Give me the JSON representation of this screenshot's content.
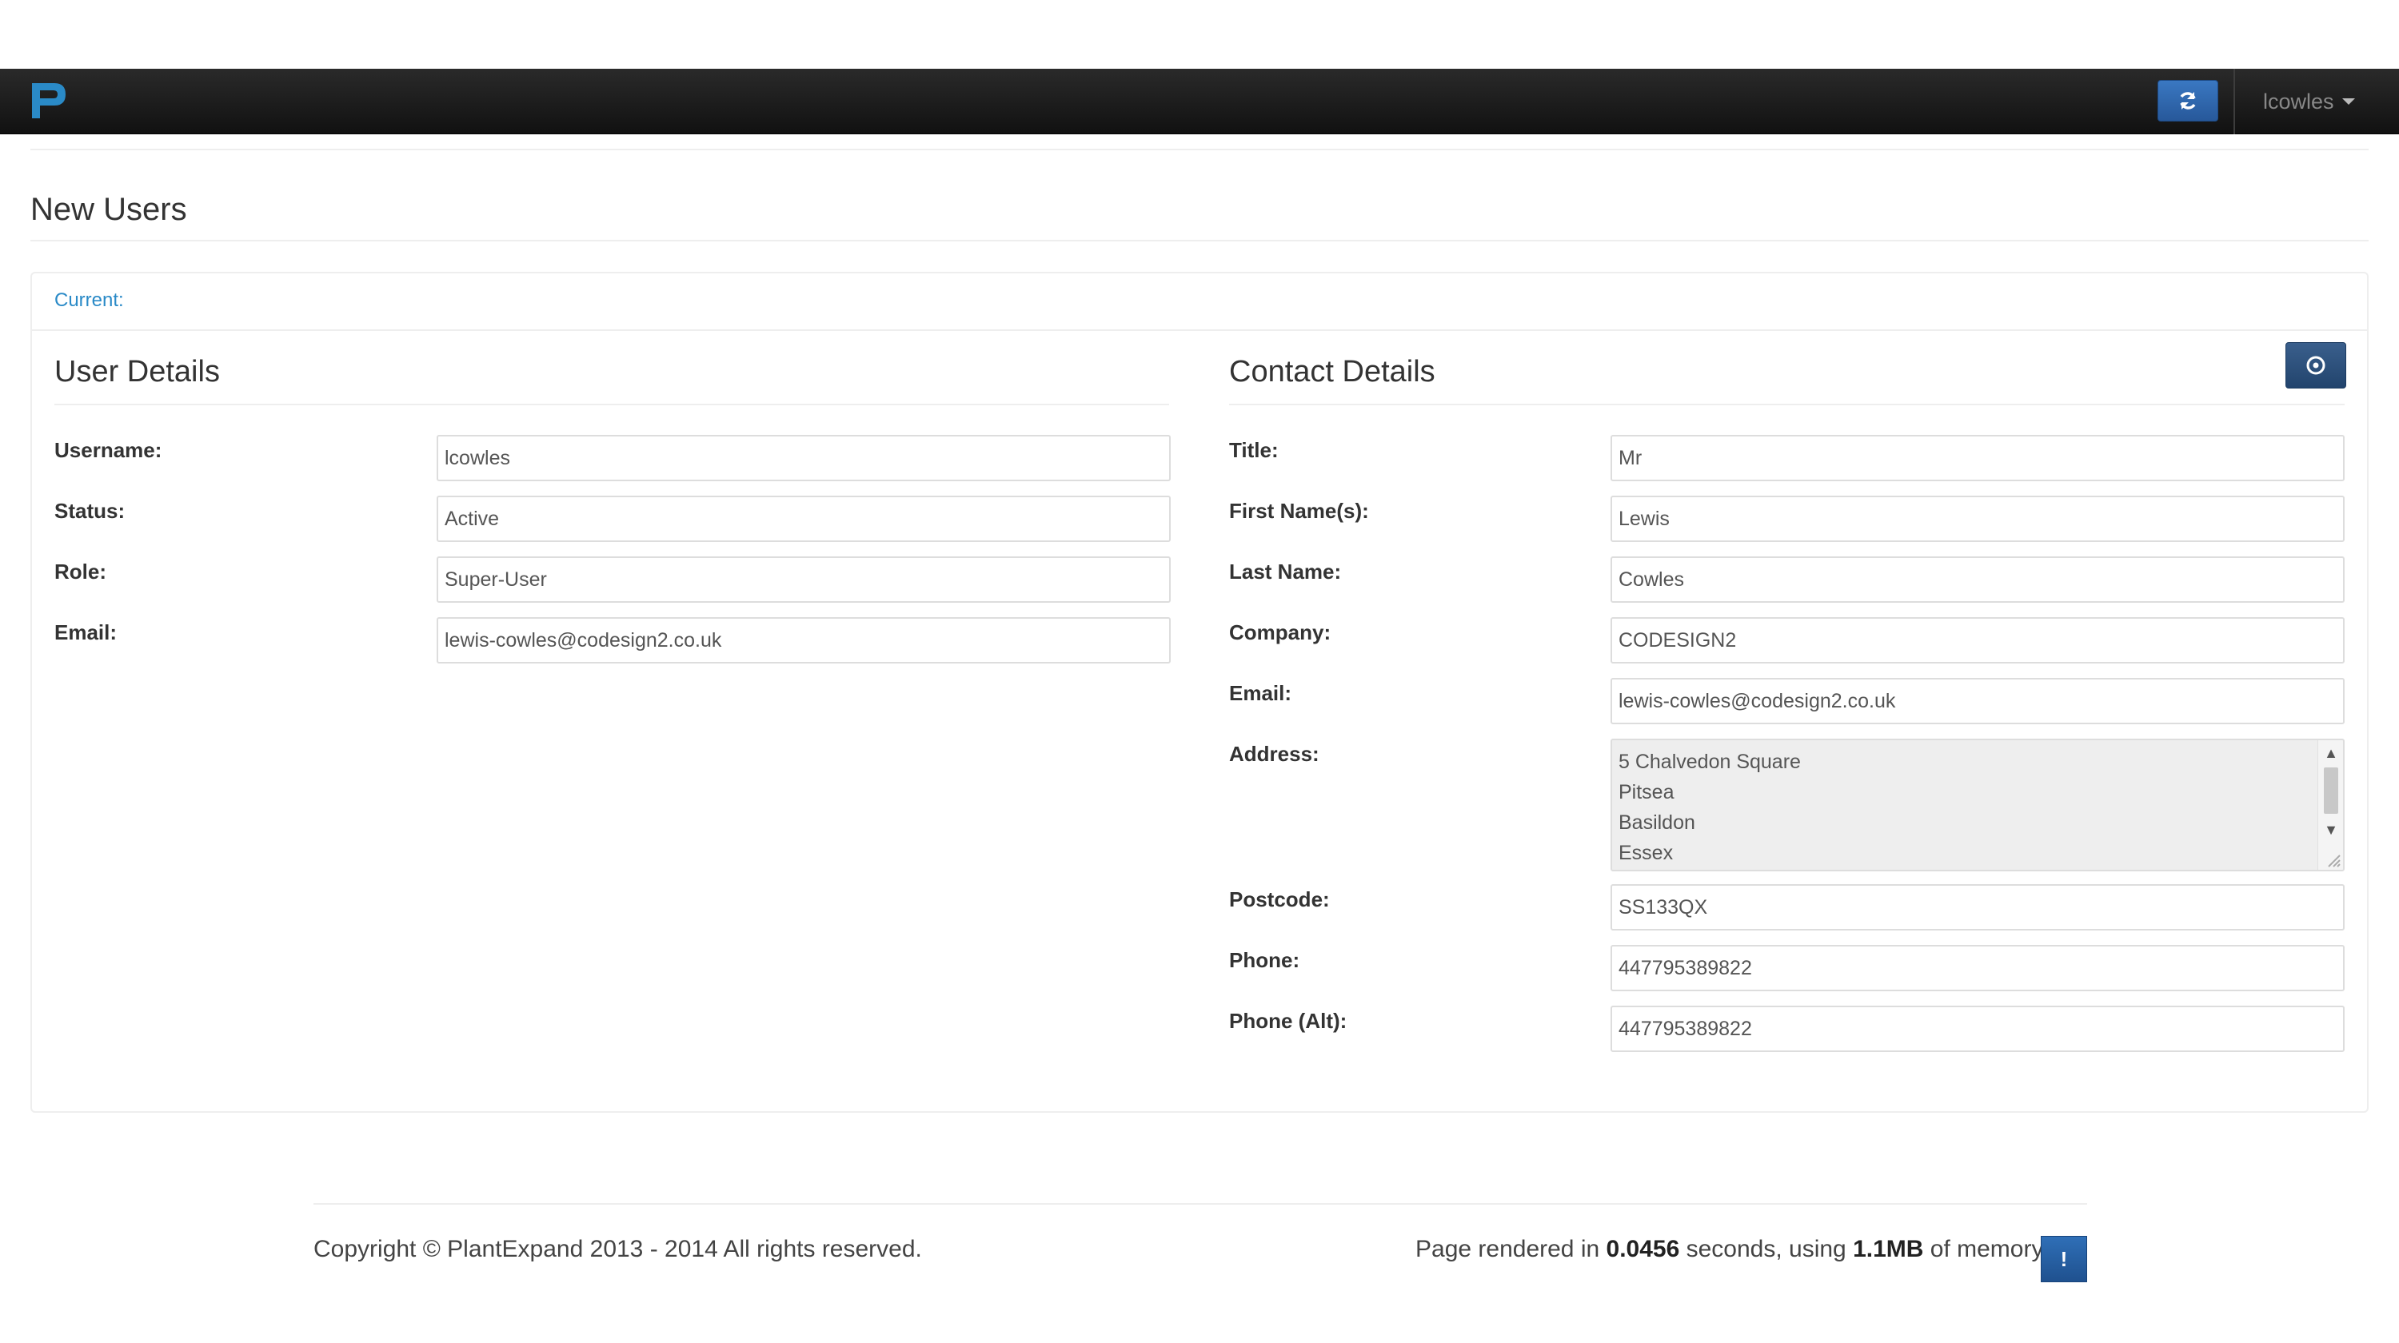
{
  "navbar": {
    "username": "lcowles",
    "icons": {
      "logo": "plantexpand-p-logo",
      "refresh": "refresh-icon",
      "caret": "caret-down-icon"
    },
    "colors": {
      "logo": "#2a8ac7",
      "refresh_button": "#3370b7"
    }
  },
  "page": {
    "title": "New Users"
  },
  "panel": {
    "current_link": "Current:"
  },
  "user_details": {
    "title": "User Details",
    "fields": [
      {
        "label": "Username:",
        "value": "lcowles"
      },
      {
        "label": "Status:",
        "value": "Active"
      },
      {
        "label": "Role:",
        "value": "Super-User"
      },
      {
        "label": "Email:",
        "value": "lewis-cowles@codesign2.co.uk"
      }
    ]
  },
  "contact_details": {
    "title": "Contact Details",
    "options_icon": "circle-dot-icon",
    "fields": [
      {
        "label": "Title:",
        "value": "Mr"
      },
      {
        "label": "First Name(s):",
        "value": "Lewis"
      },
      {
        "label": "Last Name:",
        "value": "Cowles"
      },
      {
        "label": "Company:",
        "value": "CODESIGN2"
      },
      {
        "label": "Email:",
        "value": "lewis-cowles@codesign2.co.uk"
      }
    ],
    "address": {
      "label": "Address:",
      "lines": [
        "5 Chalvedon Square",
        "Pitsea",
        "Basildon",
        "Essex"
      ]
    },
    "fields_after": [
      {
        "label": "Postcode:",
        "value": "SS133QX"
      },
      {
        "label": "Phone:",
        "value": "447795389822"
      },
      {
        "label": "Phone (Alt):",
        "value": "447795389822"
      }
    ]
  },
  "footer": {
    "copyright": "Copyright © PlantExpand 2013 - 2014 All rights reserved.",
    "render_prefix": "Page rendered in ",
    "render_time": "0.0456",
    "render_mid": " seconds, using ",
    "memory": "1.1MB",
    "render_suffix": " of memory.",
    "info_button": "!"
  }
}
